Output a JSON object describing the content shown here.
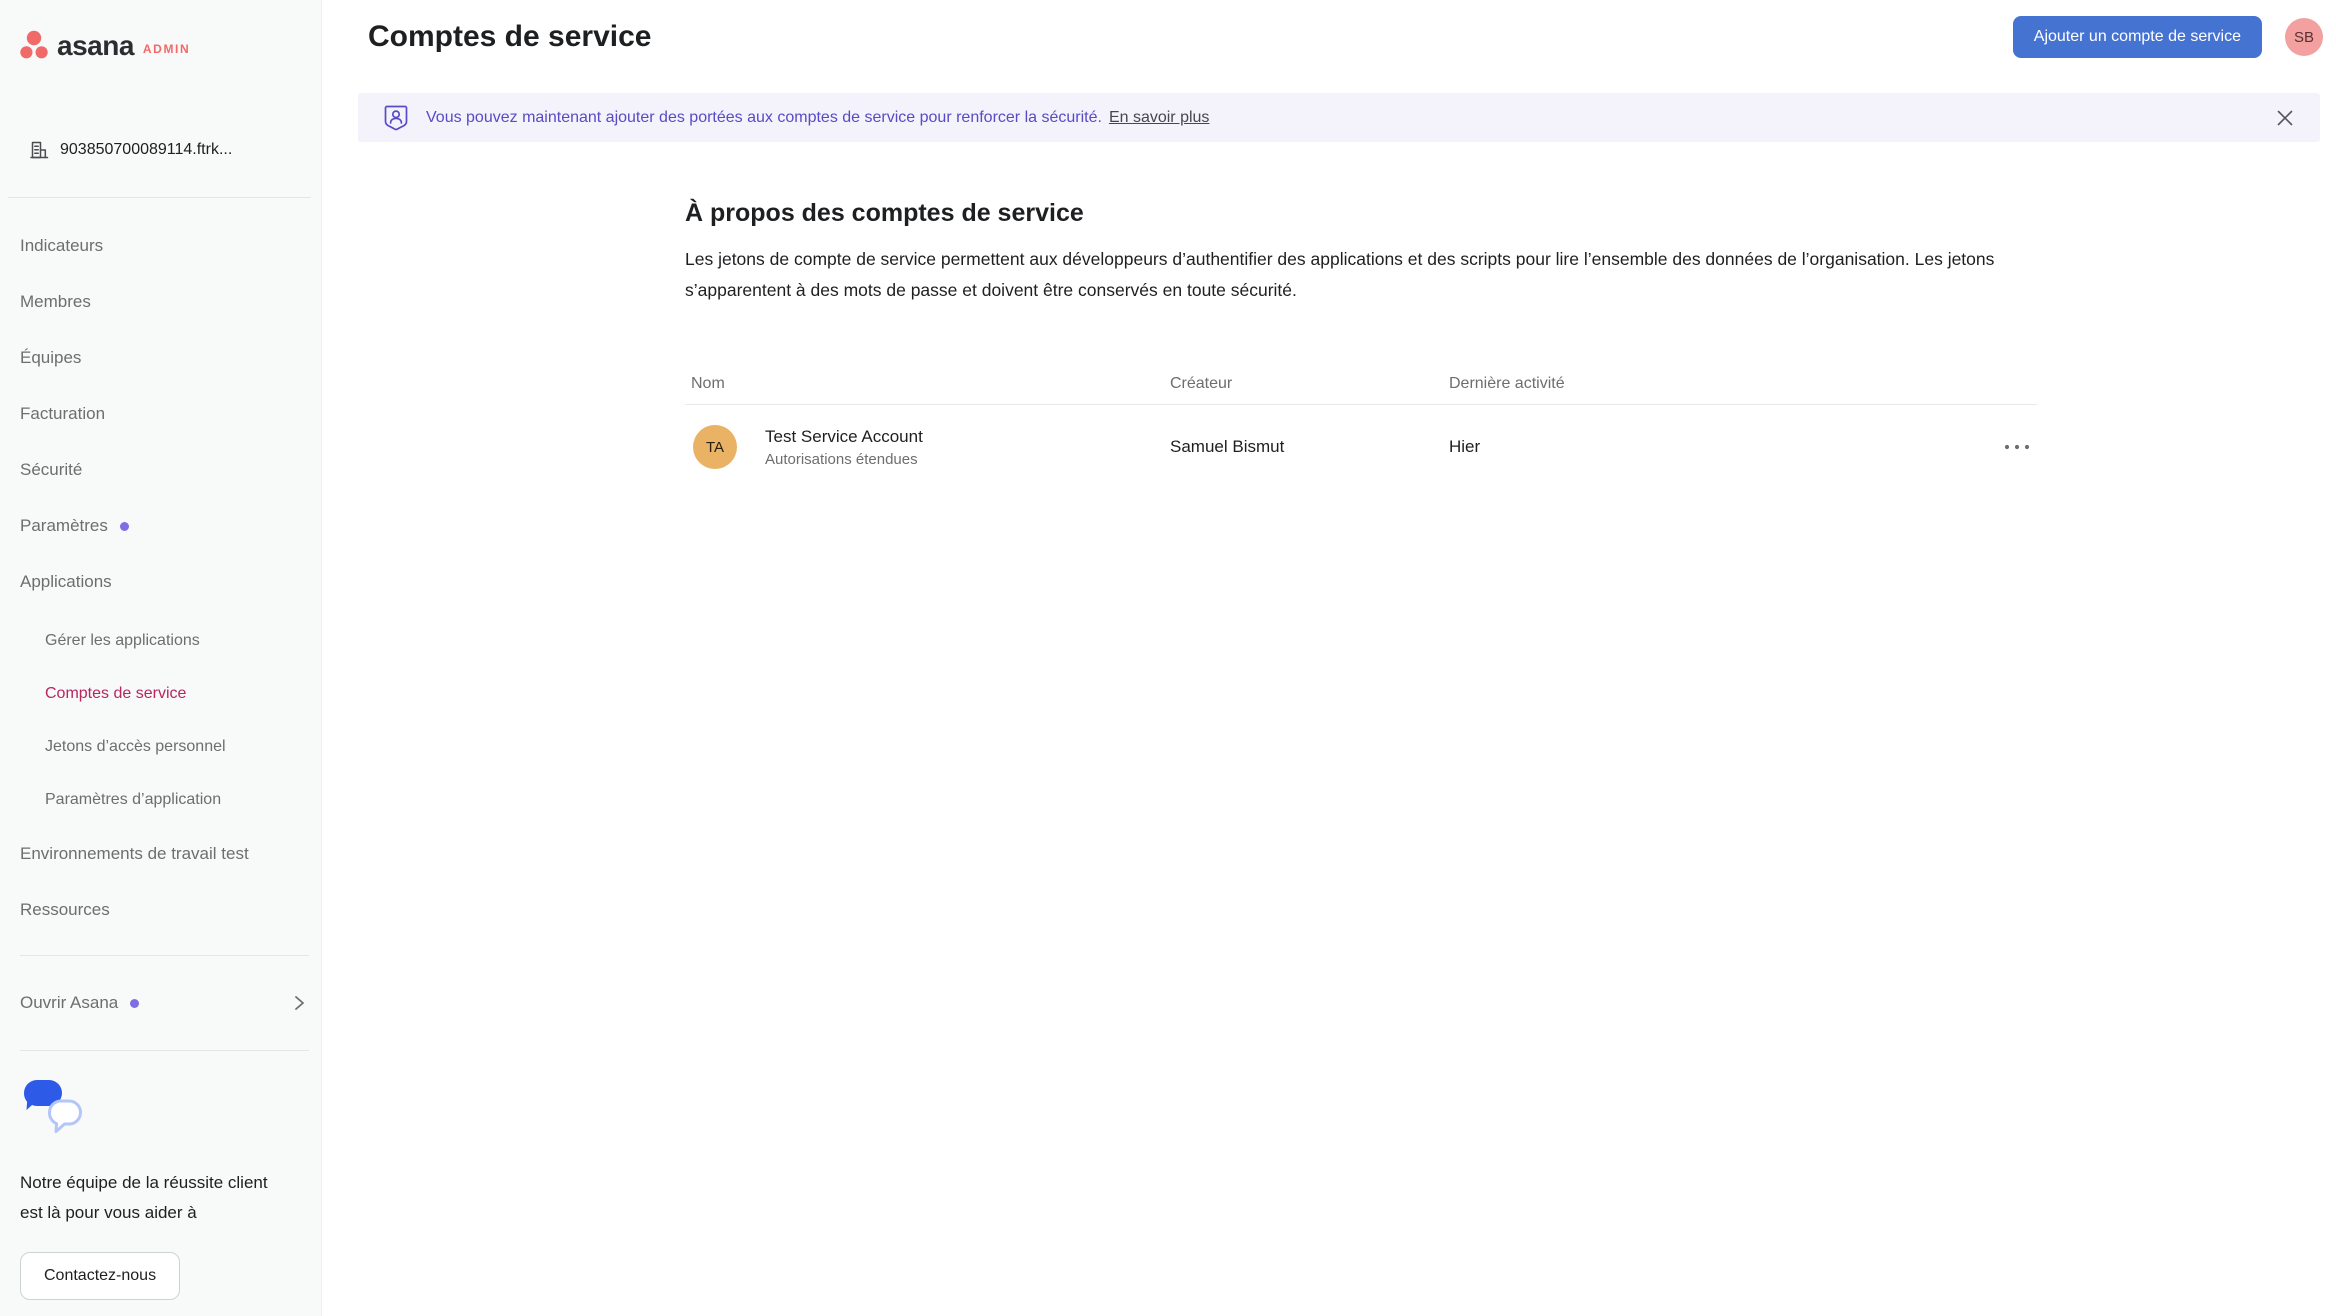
{
  "brand": {
    "logo_text": "asana",
    "logo_badge": "ADMIN",
    "coral": "#f06a6a"
  },
  "sidebar": {
    "org_id": "903850700089114.ftrk...",
    "items": [
      {
        "label": "Indicateurs"
      },
      {
        "label": "Membres"
      },
      {
        "label": "Équipes"
      },
      {
        "label": "Facturation"
      },
      {
        "label": "Sécurité"
      },
      {
        "label": "Paramètres",
        "badge_dot": true
      },
      {
        "label": "Applications"
      }
    ],
    "sub_items": [
      {
        "label": "Gérer les applications"
      },
      {
        "label": "Comptes de service",
        "active": true
      },
      {
        "label": "Jetons d’accès personnel"
      },
      {
        "label": "Paramètres d’application"
      }
    ],
    "items_after": [
      {
        "label": "Environnements de travail test"
      },
      {
        "label": "Ressources"
      }
    ],
    "open_asana": {
      "label": "Ouvrir Asana",
      "badge_dot": true
    },
    "help": {
      "text": "Notre équipe de la réussite client est là pour vous aider à",
      "button_label": "Contactez-nous"
    }
  },
  "header": {
    "title": "Comptes de service",
    "add_button_label": "Ajouter un compte de service",
    "avatar_initials": "SB"
  },
  "banner": {
    "message": "Vous pouvez maintenant ajouter des portées aux comptes de service pour renforcer la sécurité.",
    "link_label": "En savoir plus"
  },
  "about": {
    "heading": "À propos des comptes de service",
    "body": "Les jetons de compte de service permettent aux développeurs d’authentifier des applications et des scripts pour lire l’ensemble des données de l’organisation. Les jetons s’apparentent à des mots de passe et doivent être conservés en toute sécurité."
  },
  "table": {
    "columns": [
      "Nom",
      "Créateur",
      "Dernière activité"
    ],
    "rows": [
      {
        "avatar_initials": "TA",
        "name": "Test Service Account",
        "name_subtitle": "Autorisations étendues",
        "creator": "Samuel Bismut",
        "last_activity": "Hier"
      }
    ]
  }
}
